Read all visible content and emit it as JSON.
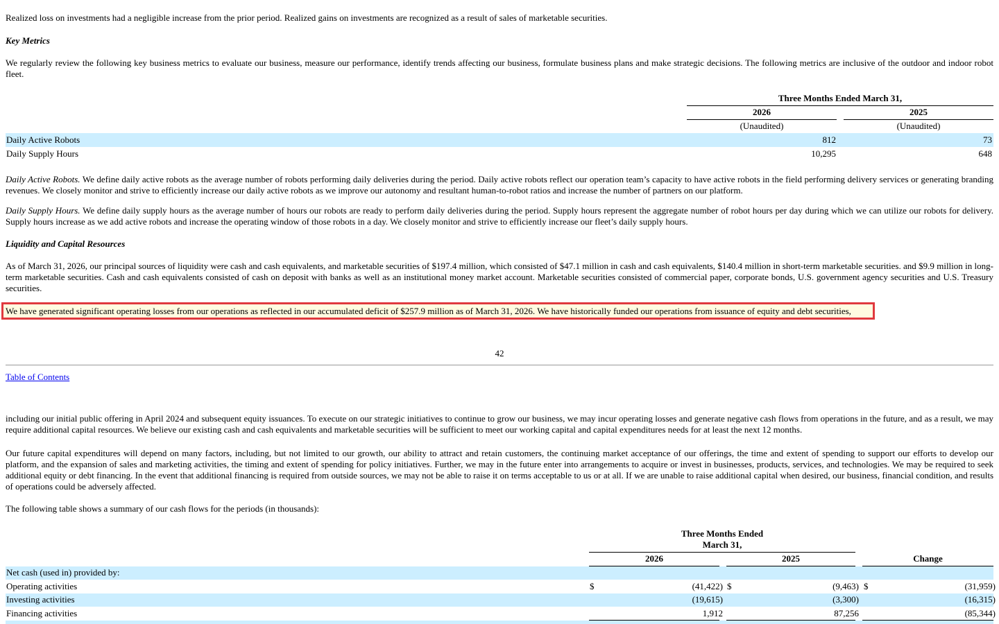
{
  "top_text": "Realized loss on investments had a negligible increase from the prior period. Realized gains on investments are recognized as a result of sales of marketable securities.",
  "key_metrics": {
    "heading": "Key Metrics",
    "intro": "We regularly review the following key business metrics to evaluate our business, measure our performance, identify trends affecting our business, formulate business plans and make strategic decisions. The following metrics are inclusive of the outdoor and indoor robot fleet.",
    "table": {
      "period_header": "Three Months Ended March 31,",
      "years": [
        "2026",
        "2025"
      ],
      "sub": [
        "(Unaudited)",
        "(Unaudited)"
      ],
      "rows": [
        {
          "label": "Daily Active Robots",
          "v2026": "812",
          "v2025": "73"
        },
        {
          "label": "Daily Supply Hours",
          "v2026": "10,295",
          "v2025": "648"
        }
      ]
    },
    "def_active_term": "Daily Active Robots.",
    "def_active_text": " We define daily active robots as the average number of robots performing daily deliveries during the period. Daily active robots reflect our operation team’s capacity to have active robots in the field performing delivery services or generating branding revenues. We closely monitor and strive to efficiently increase our daily active robots as we improve our autonomy and resultant human-to-robot ratios and increase the number of partners on our platform.",
    "def_supply_term": "Daily Supply Hours.",
    "def_supply_text": " We define daily supply hours as the average number of hours our robots are ready to perform daily deliveries during the period. Supply hours represent the aggregate number of robot hours per day during which we can utilize our robots for delivery. Supply hours increase as we add active robots and increase the operating window of those robots in a day. We closely monitor and strive to efficiently increase our fleet’s daily supply hours."
  },
  "liquidity": {
    "heading": "Liquidity and Capital Resources",
    "p1": "As of March 31, 2026, our principal sources of liquidity were cash and cash equivalents, and marketable securities of $197.4 million, which consisted of $47.1 million in cash and cash equivalents, $140.4 million in short-term marketable securities. and $9.9 million in long-term marketable securities. Cash and cash equivalents consisted of cash on deposit with banks as well as an institutional money market account. Marketable securities consisted of commercial paper, corporate bonds, U.S. government agency securities and U.S. Treasury securities.",
    "highlighted": "We have generated significant operating losses from our operations as reflected in our accumulated deficit of $257.9 million as of March 31, 2026. We have historically funded our operations from issuance of equity and debt securities,"
  },
  "page_number": "42",
  "toc_link": "Table of Contents",
  "continued": {
    "p1": "including our initial public offering in April 2024 and subsequent equity issuances. To execute on our strategic initiatives to continue to grow our business, we may incur operating losses and generate negative cash flows from operations in the future, and as a result, we may require additional capital resources. We believe our existing cash and cash equivalents and marketable securities will be sufficient to meet our working capital and capital expenditures needs for at least the next 12 months.",
    "p2": "Our future capital expenditures will depend on many factors, including, but not limited to our growth, our ability to attract and retain customers, the continuing market acceptance of our offerings, the time and extent of spending to support our efforts to develop our platform, and the expansion of sales and marketing activities, the timing and extent of spending for policy initiatives. Further, we may in the future enter into arrangements to acquire or invest in businesses, products, services, and technologies. We may be required to seek additional equity or debt financing. In the event that additional financing is required from outside sources, we may not be able to raise it on terms acceptable to us or at all. If we are unable to raise additional capital when desired, our business, financial condition, and results of operations could be adversely affected.",
    "p3": "The following table shows a summary of our cash flows for the periods (in thousands):"
  },
  "cash_flow": {
    "period_header_1": "Three Months Ended",
    "period_header_2": "March 31,",
    "years": [
      "2026",
      "2025"
    ],
    "change": "Change",
    "section_label": "Net cash (used in) provided by:",
    "currency": "$",
    "rows": [
      {
        "label": "Operating activities",
        "v2026": "(41,422)",
        "v2025": "(9,463)",
        "change": "(31,959)"
      },
      {
        "label": "Investing activities",
        "v2026": "(19,615)",
        "v2025": "(3,300)",
        "change": "(16,315)"
      },
      {
        "label": "Financing activities",
        "v2026": "1,912",
        "v2025": "87,256",
        "change": "(85,344)"
      }
    ]
  }
}
